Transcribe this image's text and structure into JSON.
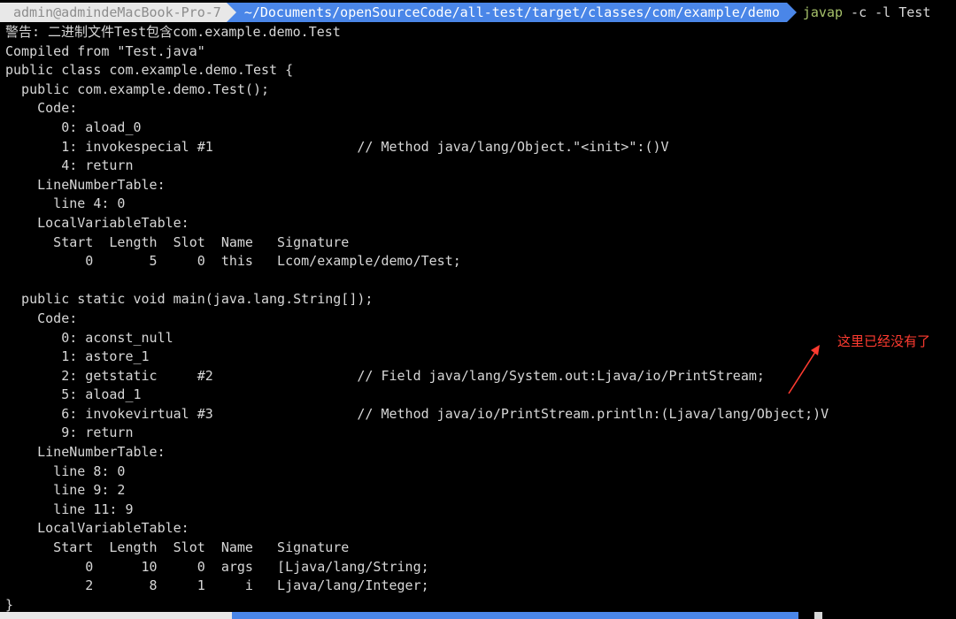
{
  "prompt": {
    "user_host": "admin@admindeMacBook-Pro-7",
    "path": "~/Documents/openSourceCode/all-test/target/classes/com/example/demo",
    "command": "javap",
    "args": " -c -l Test"
  },
  "output_lines": [
    "警告: 二进制文件Test包含com.example.demo.Test",
    "Compiled from \"Test.java\"",
    "public class com.example.demo.Test {",
    "  public com.example.demo.Test();",
    "    Code:",
    "       0: aload_0",
    "       1: invokespecial #1                  // Method java/lang/Object.\"<init>\":()V",
    "       4: return",
    "    LineNumberTable:",
    "      line 4: 0",
    "    LocalVariableTable:",
    "      Start  Length  Slot  Name   Signature",
    "          0       5     0  this   Lcom/example/demo/Test;",
    "",
    "  public static void main(java.lang.String[]);",
    "    Code:",
    "       0: aconst_null",
    "       1: astore_1",
    "       2: getstatic     #2                  // Field java/lang/System.out:Ljava/io/PrintStream;",
    "       5: aload_1",
    "       6: invokevirtual #3                  // Method java/io/PrintStream.println:(Ljava/lang/Object;)V",
    "       9: return",
    "    LineNumberTable:",
    "      line 8: 0",
    "      line 9: 2",
    "      line 11: 9",
    "    LocalVariableTable:",
    "      Start  Length  Slot  Name   Signature",
    "          0      10     0  args   [Ljava/lang/String;",
    "          2       8     1     i   Ljava/lang/Integer;",
    "}"
  ],
  "annotation": {
    "text": "这里已经没有了",
    "color": "#ff3b30"
  },
  "colors": {
    "background": "#000000",
    "text": "#d7d7d7",
    "user_segment": "#e8e8e8",
    "path_segment": "#4a86e8",
    "command": "#a6c16a"
  }
}
